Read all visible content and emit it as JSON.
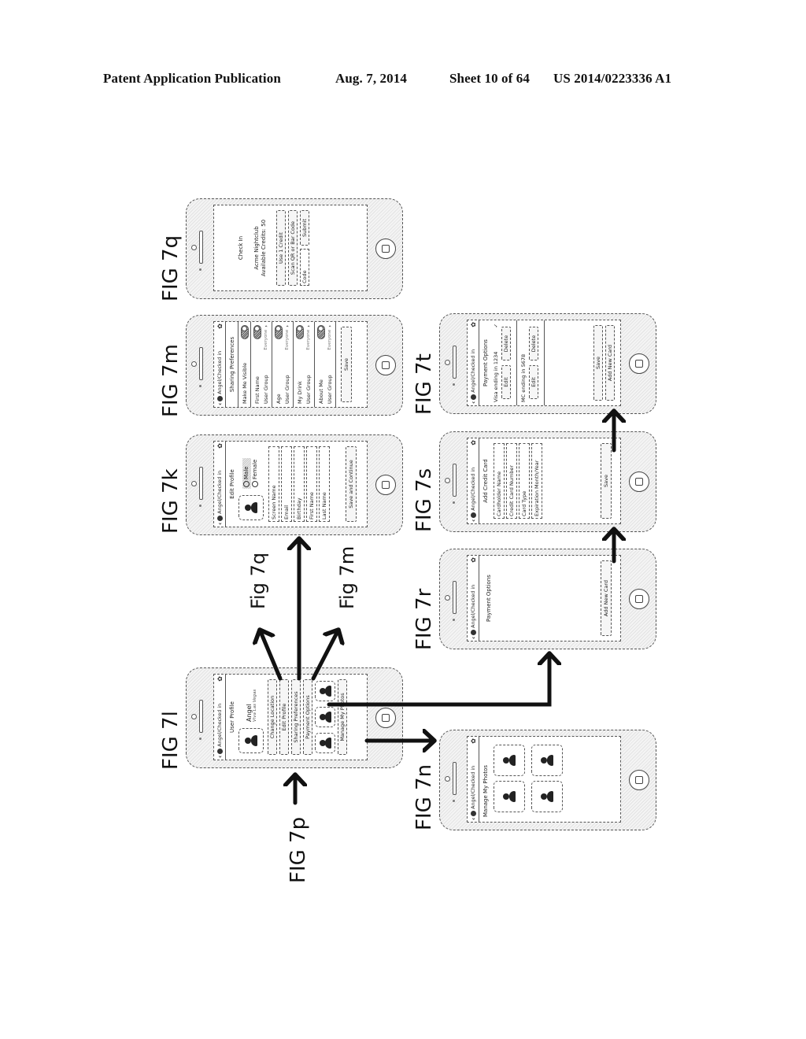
{
  "header": {
    "publication": "Patent Application Publication",
    "date": "Aug. 7, 2014",
    "sheet": "Sheet 10 of 64",
    "number": "US 2014/0223336 A1"
  },
  "nav": {
    "back_icon": "chevron-left-icon",
    "logo_icon": "app-logo-icon",
    "title": "Angel/Checked in",
    "settings_icon": "gear-icon"
  },
  "figures": {
    "fig7q": {
      "label": "FIG 7q",
      "title": "Check In",
      "venue": "Acme Nightclub",
      "credits": "Available Credits: 50",
      "buttons": [
        "Use 1 Credit",
        "Scan QR or Bar Code"
      ],
      "code_placeholder": "Code",
      "submit": "Submit"
    },
    "fig7m": {
      "label": "FIG 7m",
      "title": "Sharing Preferences",
      "rows": [
        {
          "label": "Make Me Visible",
          "toggle": true
        },
        {
          "label": "First Name",
          "toggle": true
        },
        {
          "label": "User Group",
          "value": "Everyone",
          "chevron": true
        },
        {
          "label": "Age",
          "toggle": true
        },
        {
          "label": "User Group",
          "value": "Everyone",
          "chevron": true
        },
        {
          "label": "My Drink",
          "toggle": true
        },
        {
          "label": "User Group",
          "value": "Everyone",
          "chevron": true
        },
        {
          "label": "About Me",
          "toggle": true
        },
        {
          "label": "User Group",
          "value": "Everyone",
          "chevron": true
        }
      ],
      "save": "Save"
    },
    "fig7k": {
      "label": "FIG 7k",
      "title": "Edit Profile",
      "gender_options": [
        "Male",
        "Female"
      ],
      "gender_selected": "Male",
      "fields": [
        "Screen Name",
        "Email",
        "Birthday",
        "First Name",
        "Last Name"
      ],
      "submit": "Save and Continue"
    },
    "fig7l": {
      "label": "FIG 7l",
      "title": "User Profile",
      "name": "Angel",
      "tagline": "Viva Las Vegas",
      "buttons": [
        "Change Location",
        "Edit Profile",
        "Sharing Preferences",
        "Payment Options"
      ],
      "manage_photos": "Manage My Photos"
    },
    "fig7n": {
      "label": "FIG 7n",
      "title": "Manage My Photos",
      "photo_count": 4
    },
    "fig7r": {
      "label": "FIG 7r",
      "title": "Payment Options",
      "add_card": "Add New Card"
    },
    "fig7s": {
      "label": "FIG 7s",
      "title": "Add Credit Card",
      "fields": [
        "Cardholder Name",
        "Credit Card Number",
        "Card Type",
        "Expiration Month/Year"
      ],
      "save": "Save"
    },
    "fig7t": {
      "label": "FIG 7t",
      "title": "Payment Options",
      "cards": [
        {
          "name": "Visa ending in 1234",
          "selected": true,
          "edit": "Edit",
          "delete": "Delete"
        },
        {
          "name": "MC ending in 5678",
          "selected": false,
          "edit": "Edit",
          "delete": "Delete"
        }
      ],
      "save": "Save",
      "add_card": "Add New Card"
    }
  },
  "arrow_labels": {
    "to_7q": "Fig 7q",
    "to_7m": "Fig 7m",
    "from_7p": "FIG 7p"
  }
}
